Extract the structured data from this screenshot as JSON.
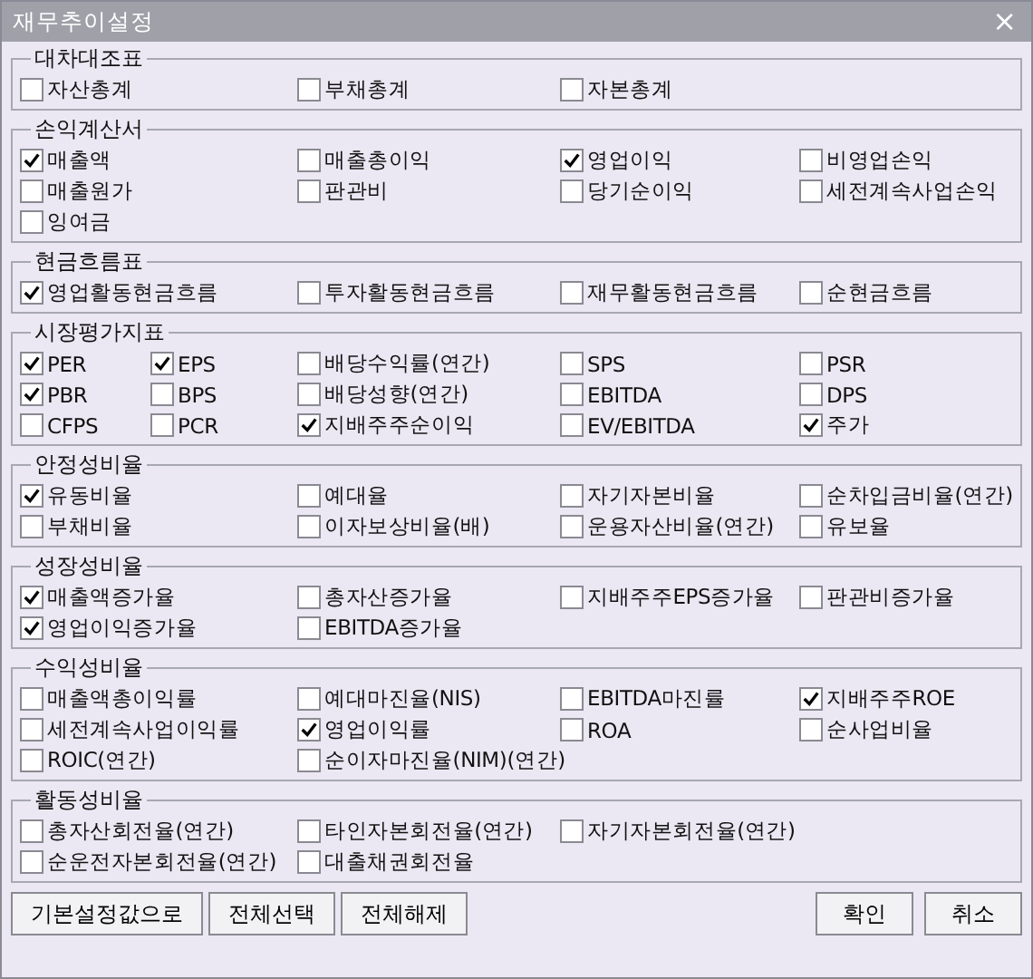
{
  "window": {
    "title": "재무추이설정",
    "close": "×"
  },
  "groups": [
    {
      "title": "대차대조표",
      "kind": "standard",
      "rows": [
        [
          {
            "label": "자산총계",
            "checked": false
          },
          {
            "label": "부채총계",
            "checked": false
          },
          {
            "label": "자본총계",
            "checked": false
          }
        ]
      ]
    },
    {
      "title": "손익계산서",
      "kind": "standard",
      "rows": [
        [
          {
            "label": "매출액",
            "checked": true
          },
          {
            "label": "매출총이익",
            "checked": false
          },
          {
            "label": "영업이익",
            "checked": true
          },
          {
            "label": "비영업손익",
            "checked": false
          }
        ],
        [
          {
            "label": "매출원가",
            "checked": false
          },
          {
            "label": "판관비",
            "checked": false
          },
          {
            "label": "당기순이익",
            "checked": false
          },
          {
            "label": "세전계속사업손익",
            "checked": false
          }
        ],
        [
          {
            "label": "잉여금",
            "checked": false
          }
        ]
      ]
    },
    {
      "title": "현금흐름표",
      "kind": "standard",
      "rows": [
        [
          {
            "label": "영업활동현금흐름",
            "checked": true
          },
          {
            "label": "투자활동현금흐름",
            "checked": false
          },
          {
            "label": "재무활동현금흐름",
            "checked": false
          },
          {
            "label": "순현금흐름",
            "checked": false
          }
        ]
      ]
    },
    {
      "title": "시장평가지표",
      "kind": "wide",
      "rows": [
        [
          {
            "label": "PER",
            "checked": true
          },
          {
            "label": "EPS",
            "checked": true
          },
          {
            "label": "배당수익률(연간)",
            "checked": false
          },
          {
            "label": "SPS",
            "checked": false
          },
          {
            "label": "PSR",
            "checked": false
          }
        ],
        [
          {
            "label": "PBR",
            "checked": true
          },
          {
            "label": "BPS",
            "checked": false
          },
          {
            "label": "배당성향(연간)",
            "checked": false
          },
          {
            "label": "EBITDA",
            "checked": false
          },
          {
            "label": "DPS",
            "checked": false
          }
        ],
        [
          {
            "label": "CFPS",
            "checked": false
          },
          {
            "label": "PCR",
            "checked": false
          },
          {
            "label": "지배주주순이익",
            "checked": true
          },
          {
            "label": "EV/EBITDA",
            "checked": false
          },
          {
            "label": "주가",
            "checked": true
          }
        ]
      ]
    },
    {
      "title": "안정성비율",
      "kind": "standard",
      "rows": [
        [
          {
            "label": "유동비율",
            "checked": true
          },
          {
            "label": "예대율",
            "checked": false
          },
          {
            "label": "자기자본비율",
            "checked": false
          },
          {
            "label": "순차입금비율(연간)",
            "checked": false
          }
        ],
        [
          {
            "label": "부채비율",
            "checked": false
          },
          {
            "label": "이자보상비율(배)",
            "checked": false
          },
          {
            "label": "운용자산비율(연간)",
            "checked": false
          },
          {
            "label": "유보율",
            "checked": false
          }
        ]
      ]
    },
    {
      "title": "성장성비율",
      "kind": "standard",
      "rows": [
        [
          {
            "label": "매출액증가율",
            "checked": true
          },
          {
            "label": "총자산증가율",
            "checked": false
          },
          {
            "label": "지배주주EPS증가율",
            "checked": false
          },
          {
            "label": "판관비증가율",
            "checked": false
          }
        ],
        [
          {
            "label": "영업이익증가율",
            "checked": true
          },
          {
            "label": "EBITDA증가율",
            "checked": false
          }
        ]
      ]
    },
    {
      "title": "수익성비율",
      "kind": "standard",
      "rows": [
        [
          {
            "label": "매출액총이익률",
            "checked": false
          },
          {
            "label": "예대마진율(NIS)",
            "checked": false
          },
          {
            "label": "EBITDA마진률",
            "checked": false
          },
          {
            "label": "지배주주ROE",
            "checked": true
          }
        ],
        [
          {
            "label": "세전계속사업이익률",
            "checked": false
          },
          {
            "label": "영업이익률",
            "checked": true
          },
          {
            "label": "ROA",
            "checked": false
          },
          {
            "label": "순사업비율",
            "checked": false
          }
        ],
        [
          {
            "label": "ROIC(연간)",
            "checked": false
          },
          {
            "label": "순이자마진율(NIM)(연간)",
            "checked": false
          }
        ]
      ]
    },
    {
      "title": "활동성비율",
      "kind": "standard",
      "rows": [
        [
          {
            "label": "총자산회전율(연간)",
            "checked": false
          },
          {
            "label": "타인자본회전율(연간)",
            "checked": false
          },
          {
            "label": "자기자본회전율(연간)",
            "checked": false
          }
        ],
        [
          {
            "label": "순운전자본회전율(연간)",
            "checked": false
          },
          {
            "label": "대출채권회전율",
            "checked": false
          }
        ]
      ]
    }
  ],
  "left_buttons": [
    "기본설정값으로",
    "전체선택",
    "전체해제"
  ],
  "right_buttons": [
    "확인",
    "취소"
  ]
}
